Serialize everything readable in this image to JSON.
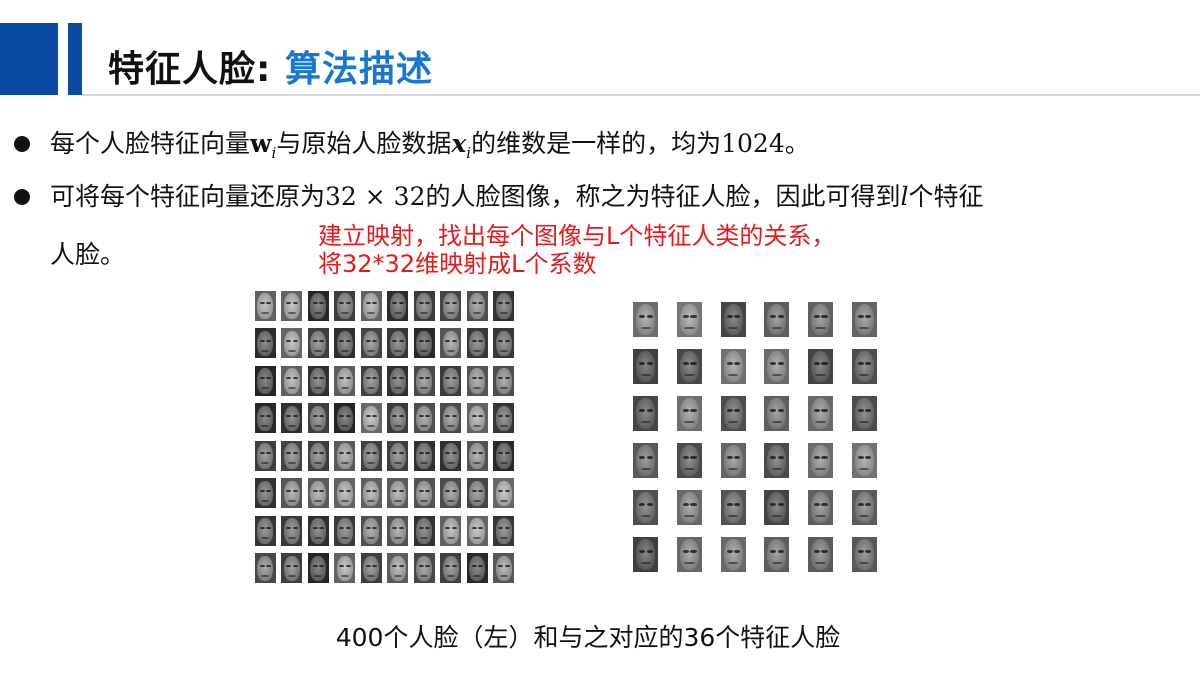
{
  "header": {
    "title_main": "特征人脸",
    "title_sep": ": ",
    "title_accent": "算法描述",
    "colors": {
      "block": "#0a4aa0",
      "accent": "#1877d2"
    }
  },
  "bullets": [
    {
      "pre": "每个人脸特征向量",
      "w": "w",
      "w_sub": "i",
      "mid": "与原始人脸数据",
      "x": "x",
      "x_sub": "i",
      "post": "的维数是一样的，均为",
      "value": "1024",
      "end": "。"
    },
    {
      "line1_pre": "可将每个特征向量还原为",
      "dim": "32 × 32",
      "line1_mid": "的人脸图像，称之为特征人脸，因此可得到",
      "l": "l",
      "line1_post": "个特征",
      "line2": "人脸。"
    }
  ],
  "annotation": {
    "line1": "建立映射，找出每个图像与L个特征人类的关系，",
    "line2": "将32*32维映射成L个系数",
    "color": "#e8191c"
  },
  "figures": {
    "left_grid": {
      "rows": 8,
      "cols": 10,
      "icon": "face-photo-icon"
    },
    "right_grid": {
      "rows": 6,
      "cols": 6,
      "icon": "eigenface-icon"
    }
  },
  "caption": "400个人脸（左）和与之对应的36个特征人脸"
}
